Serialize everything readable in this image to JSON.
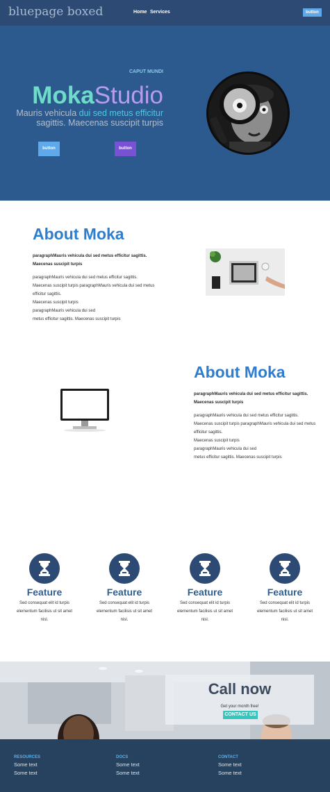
{
  "nav": {
    "brand": "bluepage boxed",
    "links": [
      "Home",
      "Services"
    ],
    "button": "button"
  },
  "hero": {
    "kicker": "CAPUT MUNDI",
    "title_part1": "Moka",
    "title_part2": "Studio",
    "subtitle_a": "Mauris vehicula ",
    "subtitle_highlight": "dui sed metus efficitur",
    "subtitle_b": "sagittis. Maecenas suscipit turpis",
    "button1": "button",
    "button2": "button"
  },
  "about1": {
    "heading": "About Moka",
    "lead": [
      "paragraphMauris vehicula dui sed metus efficitur sagittis.",
      "Maecenas suscipit turpis"
    ],
    "body": [
      "paragraphMauris vehicula dui sed metus efficitur sagittis.",
      "Maecenas suscipit turpis paragraphMauris vehicula dui sed metus",
      "efficitur sagittis.",
      "Maecenas suscipit turpis",
      "paragraphMauris vehicula dui sed",
      "metus efficitur sagittis. Maecenas suscipit turpis"
    ]
  },
  "about2": {
    "heading": "About Moka",
    "lead": [
      "paragraphMauris vehicula dui sed metus efficitur sagittis.",
      "Maecenas suscipit turpis"
    ],
    "body": [
      "paragraphMauris vehicula dui sed metus efficitur sagittis.",
      "Maecenas suscipit turpis paragraphMauris vehicula dui sed metus",
      "efficitur sagittis.",
      "Maecenas suscipit turpis",
      "paragraphMauris vehicula dui sed",
      "metus efficitur sagittis. Maecenas suscipit turpis"
    ]
  },
  "features": [
    {
      "title": "Feature",
      "text": [
        "Sed consequat elit id turpis",
        "elementum facilisis ut sit amet",
        "nisl."
      ],
      "icon": "hourglass-icon"
    },
    {
      "title": "Feature",
      "text": [
        "Sed consequat elit id turpis",
        "elementum facilisis ut sit amet",
        "nisl."
      ],
      "icon": "hourglass-icon"
    },
    {
      "title": "Feature",
      "text": [
        "Sed consequat elit id turpis",
        "elementum facilisis ut sit amet",
        "nisl."
      ],
      "icon": "hourglass-icon"
    },
    {
      "title": "Feature",
      "text": [
        "Sed consequat elit id turpis",
        "elementum facilisis ut sit amet",
        "nisl."
      ],
      "icon": "hourglass-icon"
    }
  ],
  "cta": {
    "title": "Call now",
    "subtitle": "Get your month free!",
    "button": "CONTACT US"
  },
  "footer": {
    "columns": [
      {
        "heading": "RESOURCES",
        "links": [
          "Some text",
          "Some text"
        ]
      },
      {
        "heading": "DOCS",
        "links": [
          "Some text",
          "Some text"
        ]
      },
      {
        "heading": "CONTACT",
        "links": [
          "Some text",
          "Some text"
        ]
      }
    ]
  },
  "colors": {
    "nav_bg": "#2c4a73",
    "hero_bg": "#2c5a8f",
    "accent_blue": "#5fa8ea",
    "accent_purple": "#7952d4",
    "heading_blue": "#2e7ed0",
    "teal": "#35c7be",
    "footer_bg": "#27425f"
  }
}
